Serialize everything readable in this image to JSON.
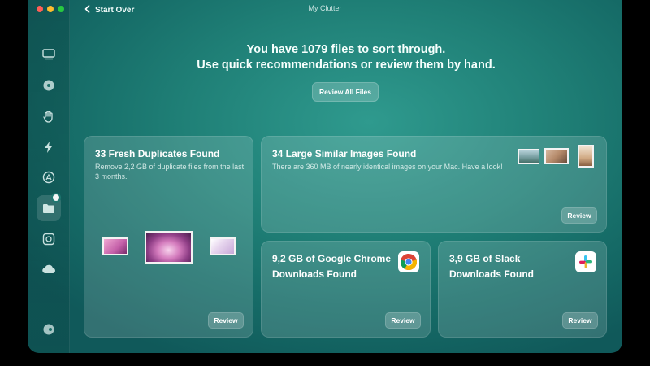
{
  "window": {
    "title": "My Clutter"
  },
  "nav": {
    "back_label": "Start Over"
  },
  "hero": {
    "line1": "You have 1079 files to sort through.",
    "line2": "Use quick recommendations or review them by hand.",
    "review_all_label": "Review All Files"
  },
  "cards": {
    "duplicates": {
      "title": "33 Fresh Duplicates Found",
      "description": "Remove 2,2 GB of duplicate files from the last 3 months.",
      "button": "Review"
    },
    "similar_images": {
      "title": "34 Large Similar Images Found",
      "description": "There are 360 MB of nearly identical images on your Mac. Have a look!",
      "button": "Review"
    },
    "chrome_downloads": {
      "title": "9,2 GB of Google Chrome Downloads Found",
      "button": "Review"
    },
    "slack_downloads": {
      "title": "3,9 GB of Slack Downloads Found",
      "button": "Review"
    }
  },
  "sidebar_icons": [
    "disk-icon",
    "drive-icon",
    "hand-icon",
    "lightning-icon",
    "app-store-icon",
    "folder-icon",
    "search-disk-icon",
    "cloud-icon",
    "account-icon"
  ],
  "colors": {
    "accent": "#1f7f76",
    "background_dark": "#10595a"
  }
}
